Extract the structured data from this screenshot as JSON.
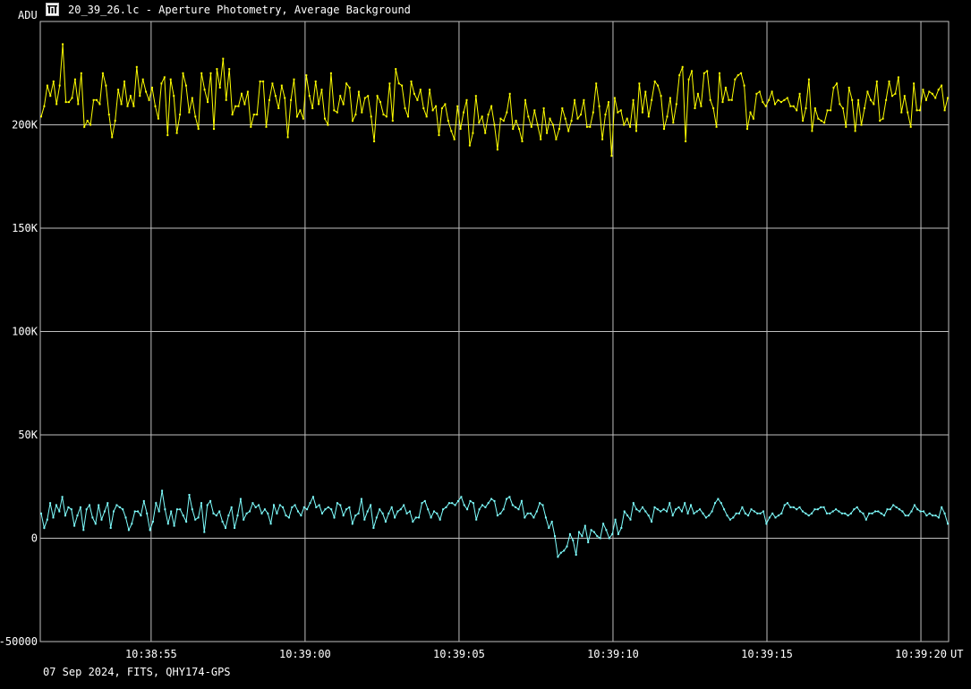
{
  "window": {
    "title": "20_39_26.lc - Aperture Photometry, Average Background",
    "icon": "app-icon"
  },
  "footer": {
    "text": "07 Sep 2024, FITS, QHY174-GPS"
  },
  "colors": {
    "background": "#000000",
    "grid": "#bfbfbf",
    "series_1": "#ffff00",
    "series_2": "#7fffff"
  },
  "chart_data": {
    "type": "line",
    "ylabel": "ADU",
    "xlabel": "UT",
    "ylim": [
      -50000,
      250000
    ],
    "yticks": [
      {
        "value": 200000,
        "label": "200K"
      },
      {
        "value": 150000,
        "label": "150K"
      },
      {
        "value": 100000,
        "label": "100K"
      },
      {
        "value": 50000,
        "label": "50K"
      },
      {
        "value": 0,
        "label": "0"
      },
      {
        "value": -50000,
        "label": "-50000"
      }
    ],
    "xlim": [
      "10:38:51.4",
      "10:39:20.9"
    ],
    "xticks": [
      "10:38:55",
      "10:39:00",
      "10:39:05",
      "10:39:10",
      "10:39:15",
      "10:39:20"
    ],
    "grid": true,
    "points_per_series": 300,
    "series": [
      {
        "color": "#ffff00",
        "values": [
          204000,
          209000,
          219000,
          214000,
          221000,
          210000,
          219000,
          239000,
          211000,
          211000,
          213000,
          222000,
          210000,
          225000,
          199000,
          202000,
          200000,
          212000,
          212000,
          210000,
          225000,
          219000,
          205000,
          194000,
          202000,
          217000,
          210000,
          221000,
          209000,
          214000,
          209000,
          228000,
          214000,
          222000,
          216000,
          212000,
          218000,
          209000,
          203000,
          220000,
          223000,
          195000,
          222000,
          214000,
          196000,
          205000,
          225000,
          219000,
          206000,
          213000,
          204000,
          198000,
          225000,
          217000,
          211000,
          225000,
          198000,
          227000,
          218000,
          232000,
          212000,
          227000,
          205000,
          209000,
          209000,
          215000,
          210000,
          216000,
          199000,
          205000,
          205000,
          221000,
          221000,
          199000,
          212000,
          220000,
          214000,
          208000,
          219000,
          213000,
          194000,
          212000,
          222000,
          204000,
          207000,
          203000,
          224000,
          214000,
          208000,
          221000,
          210000,
          217000,
          203000,
          200000,
          225000,
          207000,
          206000,
          214000,
          210000,
          220000,
          218000,
          202000,
          205000,
          216000,
          206000,
          213000,
          214000,
          204000,
          192000,
          214000,
          211000,
          205000,
          204000,
          220000,
          202000,
          227000,
          220000,
          219000,
          208000,
          204000,
          221000,
          215000,
          212000,
          217000,
          208000,
          204000,
          217000,
          207000,
          209000,
          195000,
          208000,
          210000,
          202000,
          197000,
          193000,
          209000,
          198000,
          206000,
          212000,
          190000,
          196000,
          214000,
          201000,
          204000,
          196000,
          205000,
          209000,
          200000,
          188000,
          203000,
          202000,
          206000,
          215000,
          198000,
          202000,
          198000,
          192000,
          212000,
          204000,
          199000,
          207000,
          200000,
          193000,
          208000,
          196000,
          203000,
          200000,
          193000,
          198000,
          208000,
          203000,
          197000,
          202000,
          212000,
          203000,
          205000,
          212000,
          199000,
          199000,
          206000,
          220000,
          209000,
          193000,
          205000,
          211000,
          185000,
          213000,
          206000,
          207000,
          200000,
          203000,
          199000,
          212000,
          197000,
          220000,
          206000,
          216000,
          204000,
          212000,
          221000,
          219000,
          214000,
          198000,
          204000,
          213000,
          201000,
          210000,
          224000,
          228000,
          192000,
          222000,
          226000,
          208000,
          215000,
          209000,
          225000,
          226000,
          212000,
          208000,
          199000,
          225000,
          211000,
          218000,
          212000,
          212000,
          222000,
          224000,
          225000,
          219000,
          198000,
          206000,
          203000,
          215000,
          216000,
          211000,
          209000,
          212000,
          216000,
          210000,
          212000,
          211000,
          212000,
          213000,
          209000,
          209000,
          207000,
          215000,
          202000,
          208000,
          222000,
          197000,
          208000,
          203000,
          202000,
          201000,
          207000,
          207000,
          218000,
          220000,
          210000,
          208000,
          199000,
          218000,
          212000,
          197000,
          212000,
          200000,
          208000,
          216000,
          212000,
          210000,
          221000,
          202000,
          203000,
          212000,
          221000,
          214000,
          215000,
          223000,
          206000,
          214000,
          206000,
          199000,
          220000,
          207000,
          207000,
          217000,
          212000,
          216000,
          215000,
          213000,
          217000,
          219000,
          207000,
          213000
        ]
      },
      {
        "color": "#7fffff",
        "values": [
          12000,
          5000,
          9000,
          17000,
          10000,
          16000,
          13000,
          20000,
          11000,
          15000,
          14000,
          6000,
          11000,
          15000,
          4000,
          14000,
          16000,
          10000,
          7000,
          16000,
          9000,
          13000,
          17000,
          5000,
          13000,
          16000,
          15000,
          14000,
          10000,
          4000,
          7000,
          13000,
          13000,
          11000,
          18000,
          12000,
          4000,
          8000,
          17000,
          13000,
          23000,
          14000,
          7000,
          13000,
          6000,
          14000,
          14000,
          11000,
          8000,
          21000,
          14000,
          9000,
          10000,
          17000,
          3000,
          16000,
          18000,
          12000,
          11000,
          13000,
          8000,
          5000,
          11000,
          15000,
          5000,
          11000,
          19000,
          9000,
          12000,
          13000,
          17000,
          15000,
          16000,
          12000,
          14000,
          12000,
          7000,
          16000,
          12000,
          16000,
          15000,
          11000,
          10000,
          15000,
          16000,
          13000,
          11000,
          15000,
          14000,
          17000,
          20000,
          15000,
          16000,
          12000,
          14000,
          15000,
          14000,
          10000,
          17000,
          16000,
          11000,
          14000,
          15000,
          7000,
          11000,
          12000,
          19000,
          9000,
          13000,
          16000,
          5000,
          10000,
          14000,
          12000,
          8000,
          12000,
          15000,
          10000,
          13000,
          14000,
          16000,
          12000,
          13000,
          8000,
          10000,
          10000,
          17000,
          18000,
          14000,
          10000,
          13000,
          12000,
          9000,
          14000,
          15000,
          17000,
          17000,
          16000,
          18000,
          20000,
          16000,
          14000,
          18000,
          17000,
          9000,
          14000,
          16000,
          15000,
          17000,
          19000,
          18000,
          11000,
          12000,
          14000,
          19000,
          20000,
          16000,
          15000,
          14000,
          18000,
          10000,
          12000,
          12000,
          10000,
          13000,
          17000,
          16000,
          10000,
          5000,
          8000,
          1000,
          -9000,
          -7000,
          -6000,
          -4000,
          2000,
          -1000,
          -8000,
          3000,
          1000,
          6000,
          -2000,
          4000,
          3000,
          1000,
          0,
          7000,
          4000,
          0,
          2000,
          9000,
          2000,
          5000,
          13000,
          11000,
          9000,
          17000,
          14000,
          13000,
          15000,
          13000,
          11000,
          8000,
          15000,
          14000,
          13000,
          14000,
          13000,
          17000,
          11000,
          14000,
          15000,
          13000,
          17000,
          12000,
          16000,
          12000,
          13000,
          14000,
          12000,
          10000,
          11000,
          13000,
          17000,
          19000,
          17000,
          14000,
          11000,
          9000,
          10000,
          12000,
          12000,
          15000,
          12000,
          11000,
          14000,
          13000,
          12000,
          12000,
          13000,
          7000,
          10000,
          12000,
          10000,
          11000,
          12000,
          16000,
          17000,
          15000,
          15000,
          14000,
          15000,
          13000,
          12000,
          11000,
          12000,
          14000,
          14000,
          15000,
          15000,
          12000,
          12000,
          13000,
          14000,
          13000,
          12000,
          12000,
          11000,
          12000,
          14000,
          15000,
          13000,
          12000,
          9000,
          12000,
          12000,
          13000,
          13000,
          12000,
          11000,
          14000,
          14000,
          16000,
          15000,
          14000,
          13000,
          11000,
          11000,
          13000,
          16000,
          14000,
          13000,
          13000,
          11000,
          12000,
          11000,
          11000,
          10000,
          15000,
          12000,
          7000
        ]
      }
    ]
  }
}
